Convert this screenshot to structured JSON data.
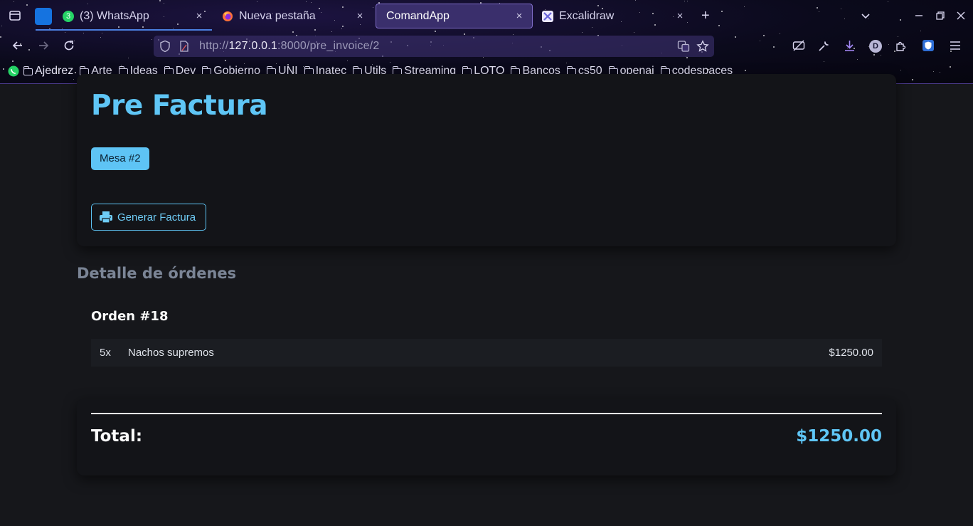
{
  "browser": {
    "tabs": [
      {
        "title": "(3) WhatsApp",
        "icon": "whatsapp-icon",
        "badge": "3"
      },
      {
        "title": "Nueva pestaña",
        "icon": "firefox-icon"
      },
      {
        "title": "ComandApp",
        "icon": "sparkle-icon",
        "active": true
      },
      {
        "title": "Excalidraw",
        "icon": "excalidraw-icon"
      }
    ],
    "close_glyph": "×",
    "new_tab_glyph": "+",
    "url_prefix": "http://",
    "url_host": "127.0.0.1",
    "url_rest": ":8000/pre_invoice/2",
    "profile_initial": "D",
    "bookmarks": [
      "Ajedrez",
      "Arte",
      "Ideas",
      "Dev",
      "Gobierno",
      "UNI",
      "Inatec",
      "Utils",
      "Streaming",
      "LOTO",
      "Bancos",
      "cs50",
      "openai",
      "codespaces"
    ]
  },
  "page": {
    "title": "Pre Factura",
    "table_badge": "Mesa #2",
    "invoice_button": "Generar Factura",
    "orders_heading": "Detalle de órdenes",
    "orders": [
      {
        "title": "Orden #18",
        "items": [
          {
            "qty": "5x",
            "name": "Nachos supremos",
            "price": "$1250.00"
          }
        ]
      }
    ],
    "total_label": "Total:",
    "total_value": "$1250.00"
  },
  "colors": {
    "accent": "#5ec4f5",
    "page_bg": "#16171b",
    "card_bg": "#131418",
    "muted_heading": "#7b8596"
  }
}
